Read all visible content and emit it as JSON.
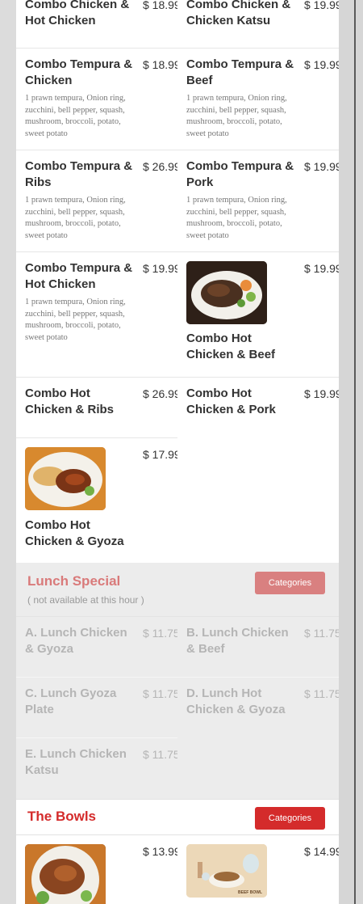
{
  "combo_section": {
    "items": [
      {
        "name": "Combo Chicken & Hot Chicken",
        "price": "$ 18.99",
        "description": ""
      },
      {
        "name": "Combo Chicken & Chicken Katsu",
        "price": "$ 19.99",
        "description": ""
      },
      {
        "name": "Combo Tempura & Chicken",
        "price": "$ 18.99",
        "description": "1 prawn tempura, Onion ring, zucchini, bell pepper, squash, mushroom, broccoli, potato, sweet potato"
      },
      {
        "name": "Combo Tempura & Beef",
        "price": "$ 19.99",
        "description": "1 prawn tempura, Onion ring, zucchini, bell pepper, squash, mushroom, broccoli, potato, sweet potato"
      },
      {
        "name": "Combo Tempura & Ribs",
        "price": "$ 26.99",
        "description": "1 prawn tempura, Onion ring, zucchini, bell pepper, squash, mushroom, broccoli, potato, sweet potato"
      },
      {
        "name": "Combo Tempura & Pork",
        "price": "$ 19.99",
        "description": "1 prawn tempura, Onion ring, zucchini, bell pepper, squash, mushroom, broccoli, potato, sweet potato"
      },
      {
        "name": "Combo Tempura & Hot Chicken",
        "price": "$ 19.99",
        "description": "1 prawn tempura, Onion ring, zucchini, bell pepper, squash, mushroom, broccoli, potato, sweet potato"
      },
      {
        "name": "Combo Hot Chicken & Beef",
        "price": "$ 19.99",
        "description": ""
      },
      {
        "name": "Combo Hot Chicken & Ribs",
        "price": "$ 26.99",
        "description": ""
      },
      {
        "name": "Combo Hot Chicken & Pork",
        "price": "$ 19.99",
        "description": ""
      },
      {
        "name": "Combo Hot Chicken & Gyoza",
        "price": "$ 17.99",
        "description": ""
      }
    ]
  },
  "lunch_section": {
    "title": "Lunch Special",
    "note": "( not available at this hour )",
    "categories_label": "Categories",
    "items": [
      {
        "name": "A. Lunch Chicken & Gyoza",
        "price": "$ 11.75"
      },
      {
        "name": "B. Lunch Chicken & Beef",
        "price": "$ 11.75"
      },
      {
        "name": "C. Lunch Gyoza Plate",
        "price": "$ 11.75"
      },
      {
        "name": "D. Lunch Hot Chicken & Gyoza",
        "price": "$ 11.75"
      },
      {
        "name": "E. Lunch Chicken Katsu",
        "price": "$ 11.75"
      }
    ]
  },
  "bowls_section": {
    "title": "The Bowls",
    "categories_label": "Categories",
    "items": [
      {
        "price": "$ 13.99"
      },
      {
        "price": "$ 14.99",
        "image_caption": "BEEF BOWL"
      }
    ]
  },
  "colors": {
    "accent": "#d42b2b",
    "accent_disabled": "#d97a7a",
    "disabled_bg": "#ececec"
  }
}
